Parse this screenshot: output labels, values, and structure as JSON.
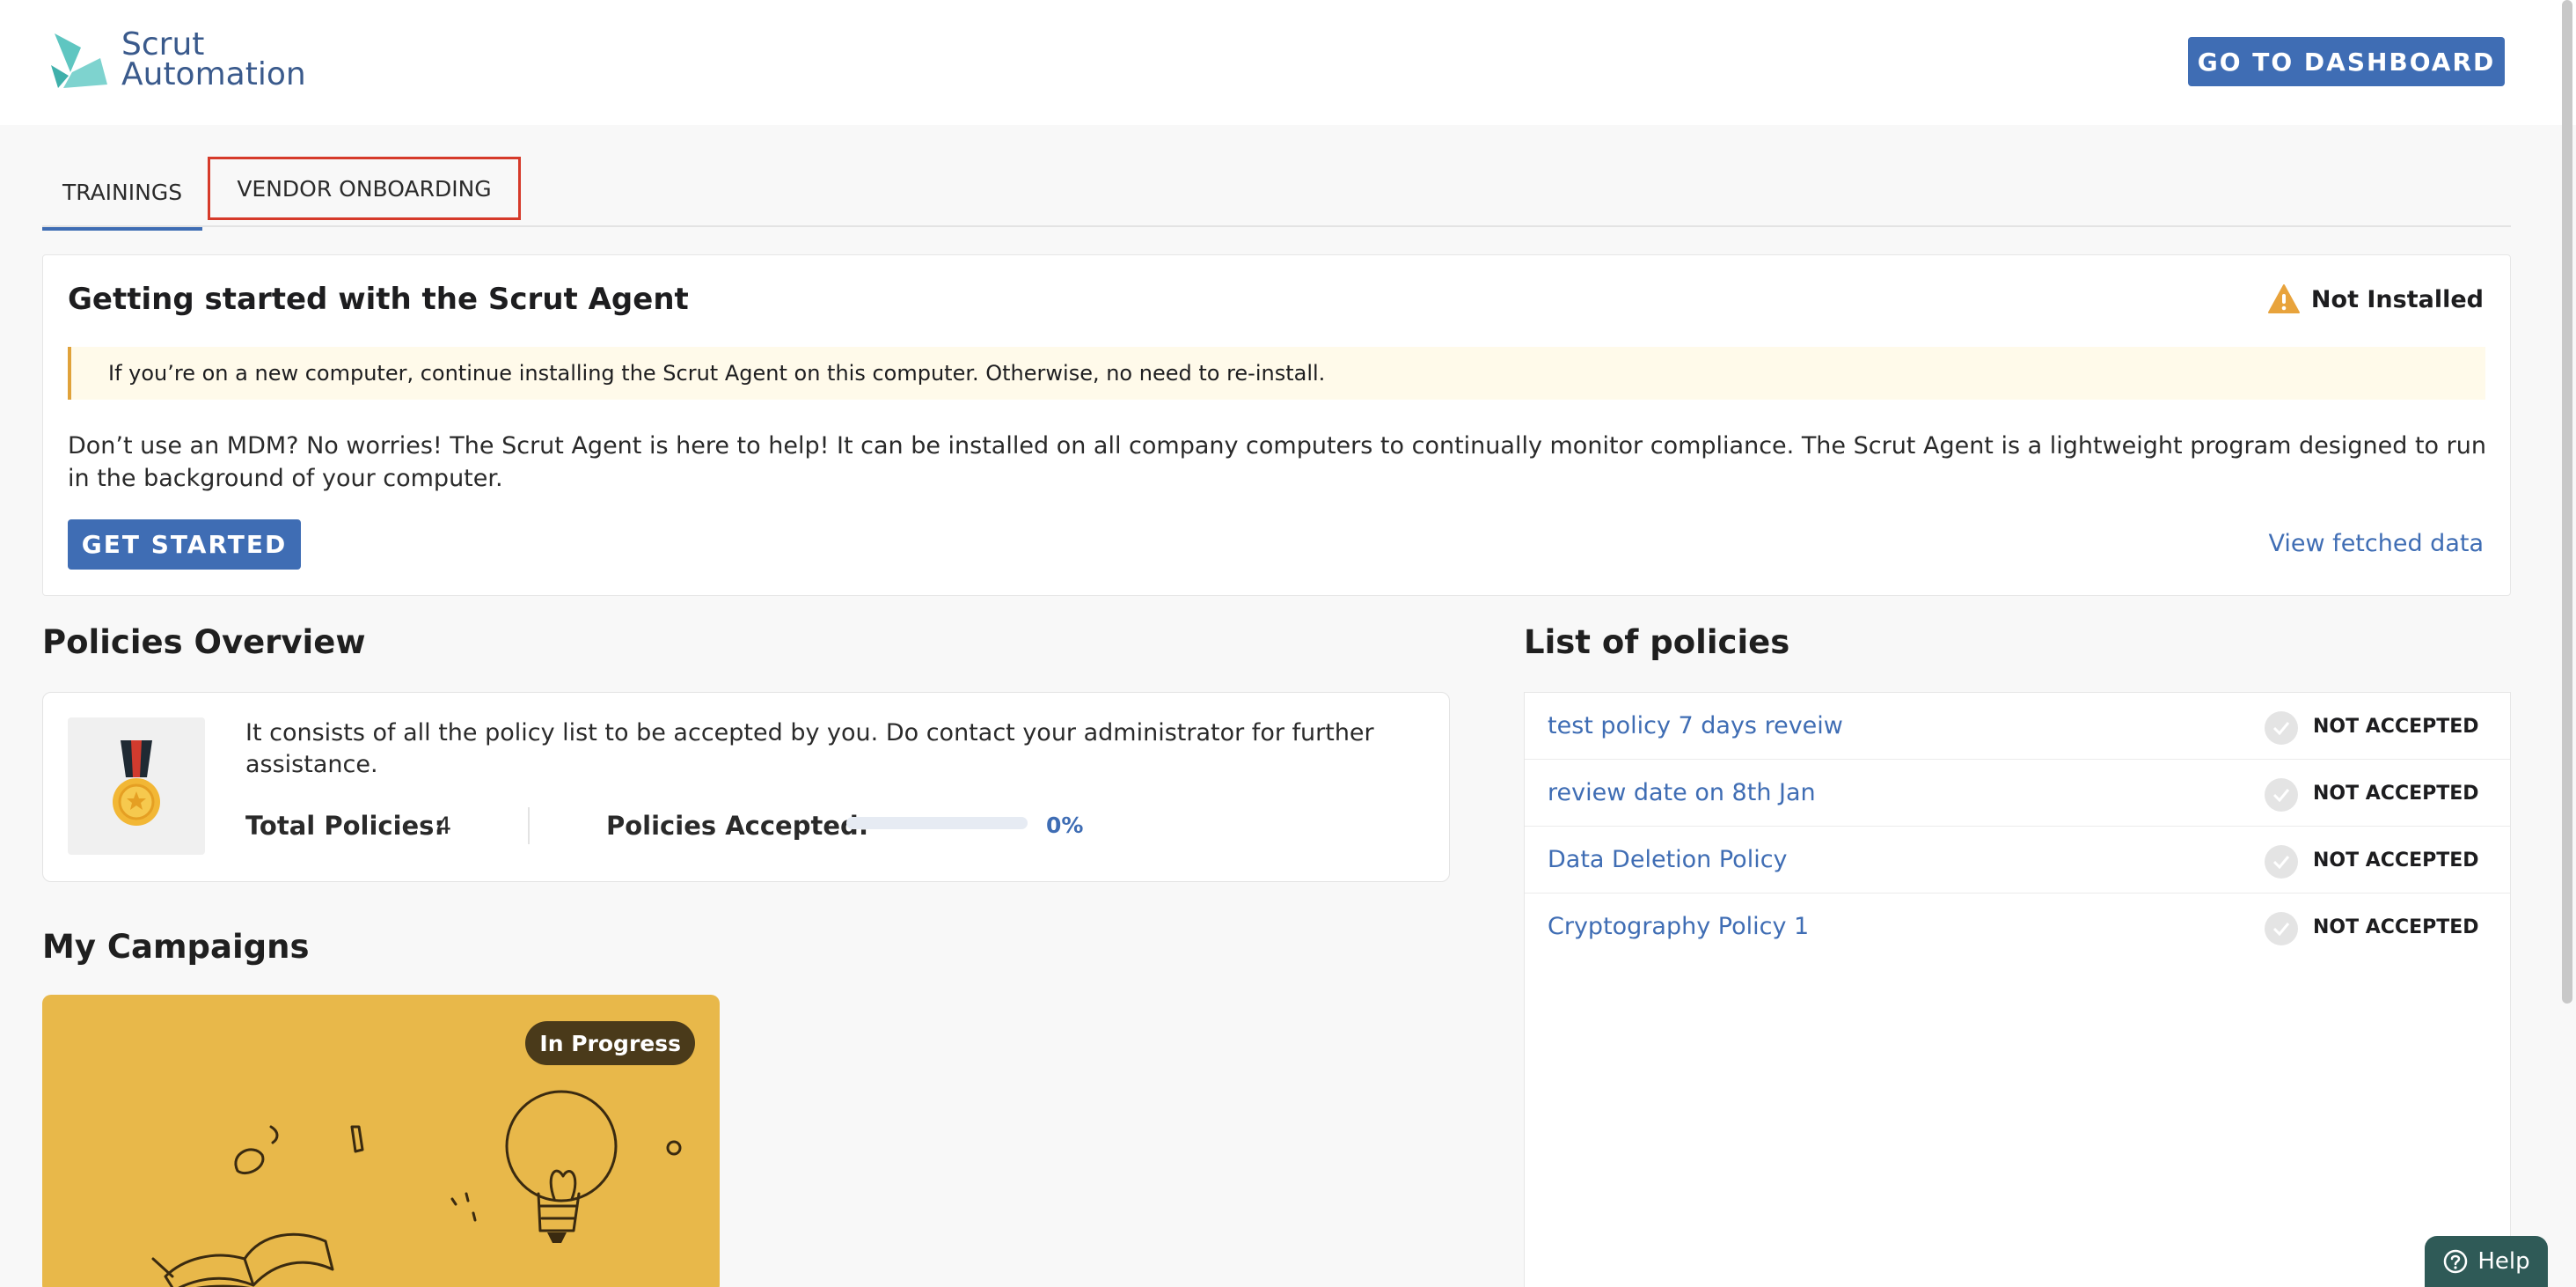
{
  "header": {
    "logo_line1": "Scrut",
    "logo_line2": "Automation",
    "dashboard_button": "GO TO DASHBOARD"
  },
  "tabs": [
    {
      "label": "TRAININGS",
      "active": true
    },
    {
      "label": "VENDOR ONBOARDING",
      "active": false,
      "highlighted": true
    }
  ],
  "agent": {
    "title": "Getting started with the Scrut Agent",
    "status": "Not Installed",
    "notice": "If you’re on a new computer, continue installing the Scrut Agent on this computer. Otherwise, no need to re-install.",
    "description": "Don’t use an MDM? No worries! The Scrut Agent is here to help! It can be installed on all company computers to continually monitor compliance. The Scrut Agent is a lightweight program designed to run in the background of your computer.",
    "start_button": "GET STARTED",
    "fetched_link": "View fetched data"
  },
  "overview": {
    "title": "Policies Overview",
    "text": "It consists of all the policy list to be accepted by you. Do contact your administrator for further assistance.",
    "total_label": "Total Policies:",
    "total_value": "4",
    "accepted_label": "Policies Accepted:",
    "accepted_percent": "0%",
    "accepted_fraction": 0
  },
  "campaigns": {
    "title": "My Campaigns",
    "items": [
      {
        "status": "In Progress"
      }
    ]
  },
  "policies": {
    "title": "List of policies",
    "items": [
      {
        "name": "test policy 7 days reveiw",
        "status": "NOT ACCEPTED"
      },
      {
        "name": "review date on 8th Jan",
        "status": "NOT ACCEPTED"
      },
      {
        "name": "Data Deletion Policy",
        "status": "NOT ACCEPTED"
      },
      {
        "name": "Cryptography Policy 1",
        "status": "NOT ACCEPTED"
      }
    ]
  },
  "help": {
    "label": "Help"
  },
  "colors": {
    "accent": "#3f6db4",
    "warning": "#e0a23a",
    "campaign_bg": "#e8b84a",
    "help_bg": "#2f5a57"
  }
}
